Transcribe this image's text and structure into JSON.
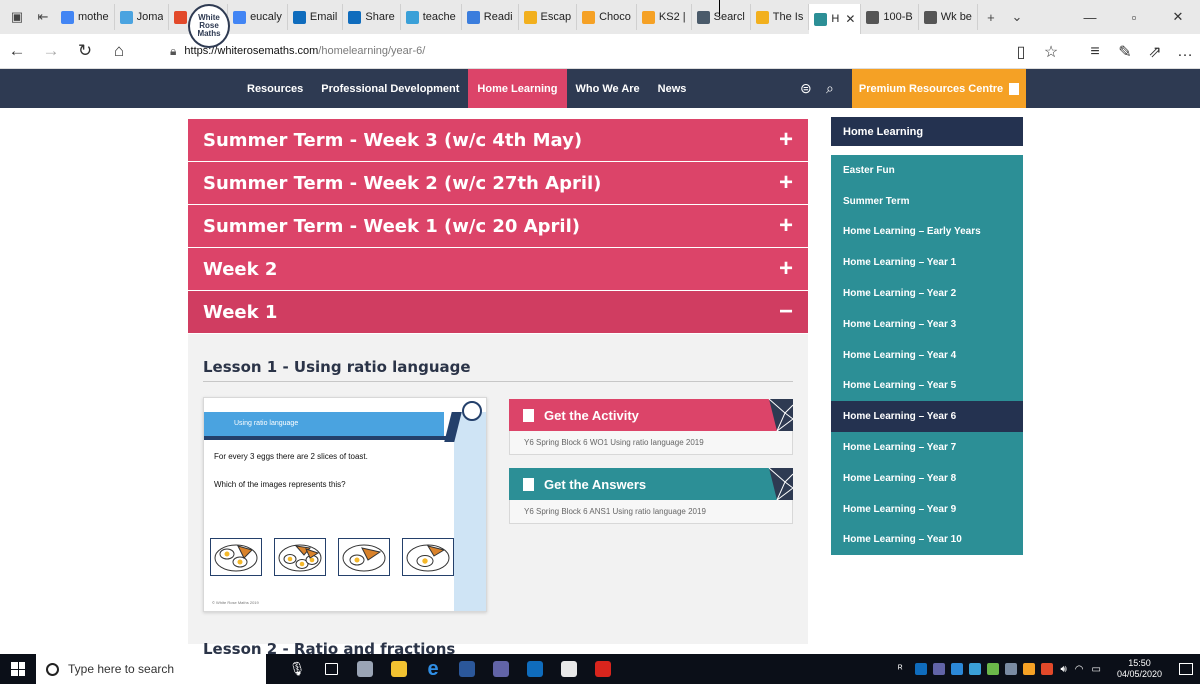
{
  "browser": {
    "tabs": [
      {
        "label": "mothe",
        "color": "#4285f4",
        "icon": "google-icon"
      },
      {
        "label": "Joma",
        "color": "#4aa3e0",
        "icon": "joma-icon"
      },
      {
        "label": "169 Fi",
        "color": "#e2492a",
        "icon": "bookmark-icon"
      },
      {
        "label": "eucaly",
        "color": "#4285f4",
        "icon": "google-icon"
      },
      {
        "label": "Email",
        "color": "#0f6cbd",
        "icon": "outlook-icon"
      },
      {
        "label": "Share",
        "color": "#0f6cbd",
        "icon": "cloud-icon"
      },
      {
        "label": "teache",
        "color": "#3aa0d8",
        "icon": "teacher-icon"
      },
      {
        "label": "Readi",
        "color": "#3b7ddd",
        "icon": "reading-icon"
      },
      {
        "label": "Escap",
        "color": "#f2b01e",
        "icon": "escape-icon"
      },
      {
        "label": "Choco",
        "color": "#f5a125",
        "icon": "chocolate-icon"
      },
      {
        "label": "KS2 |",
        "color": "#f5a125",
        "icon": "ks2-icon"
      },
      {
        "label": "Searcl",
        "color": "#4a5a6a",
        "icon": "search-site-icon"
      },
      {
        "label": "The Is",
        "color": "#f2b01e",
        "icon": "the-is-icon"
      },
      {
        "label": "H",
        "color": "#2c8f96",
        "icon": "white-rose-icon"
      },
      {
        "label": "100-B",
        "color": "#555555",
        "icon": "page-icon"
      },
      {
        "label": "Wk be",
        "color": "#555555",
        "icon": "page-icon"
      }
    ],
    "address": {
      "host": "https://whiterosemaths.com",
      "path": "/homelearning/year-6/"
    }
  },
  "site": {
    "logo_lines": [
      "White",
      "Rose",
      "Maths"
    ],
    "nav": [
      "Resources",
      "Professional Development",
      "Home Learning",
      "Who We Are",
      "News"
    ],
    "nav_active_index": 2,
    "premium_label": "Premium Resources Centre"
  },
  "accordion": {
    "rows": [
      {
        "title": "Summer Term - Week 3 (w/c 4th May)",
        "sign": "+"
      },
      {
        "title": "Summer Term - Week 2 (w/c 27th April)",
        "sign": "+"
      },
      {
        "title": "Summer Term - Week 1 (w/c 20 April)",
        "sign": "+"
      },
      {
        "title": "Week 2",
        "sign": "+"
      },
      {
        "title": "Week 1",
        "sign": "−"
      }
    ]
  },
  "lesson1": {
    "title": "Lesson 1 - Using ratio language",
    "slide": {
      "banner": "Using ratio language",
      "q1": "For every 3 eggs there are 2 slices of toast.",
      "q2": "Which of the images represents this?",
      "copyright": "© White Rose Maths 2019"
    },
    "activity": {
      "label": "Get the Activity",
      "file": "Y6 Spring Block 6 WO1 Using ratio language 2019",
      "color": "#dc4469"
    },
    "answers": {
      "label": "Get the Answers",
      "file": "Y6 Spring Block 6 ANS1 Using ratio language 2019",
      "color": "#2c8f96"
    }
  },
  "lesson2": {
    "title": "Lesson 2 - Ratio and fractions"
  },
  "sidebar": {
    "title": "Home Learning",
    "items": [
      "Easter Fun",
      "Summer Term",
      "Home Learning – Early Years",
      "Home Learning – Year 1",
      "Home Learning – Year 2",
      "Home Learning – Year 3",
      "Home Learning – Year 4",
      "Home Learning – Year 5",
      "Home Learning – Year 6",
      "Home Learning – Year 7",
      "Home Learning – Year 8",
      "Home Learning – Year 9",
      "Home Learning – Year 10"
    ],
    "active_index": 8
  },
  "taskbar": {
    "search_placeholder": "Type here to search",
    "time": "15:50",
    "date": "04/05/2020"
  },
  "colors": {
    "pink": "#dc4469",
    "navy": "#2e3a52",
    "teal": "#2c8f96",
    "orange": "#f5a125"
  }
}
